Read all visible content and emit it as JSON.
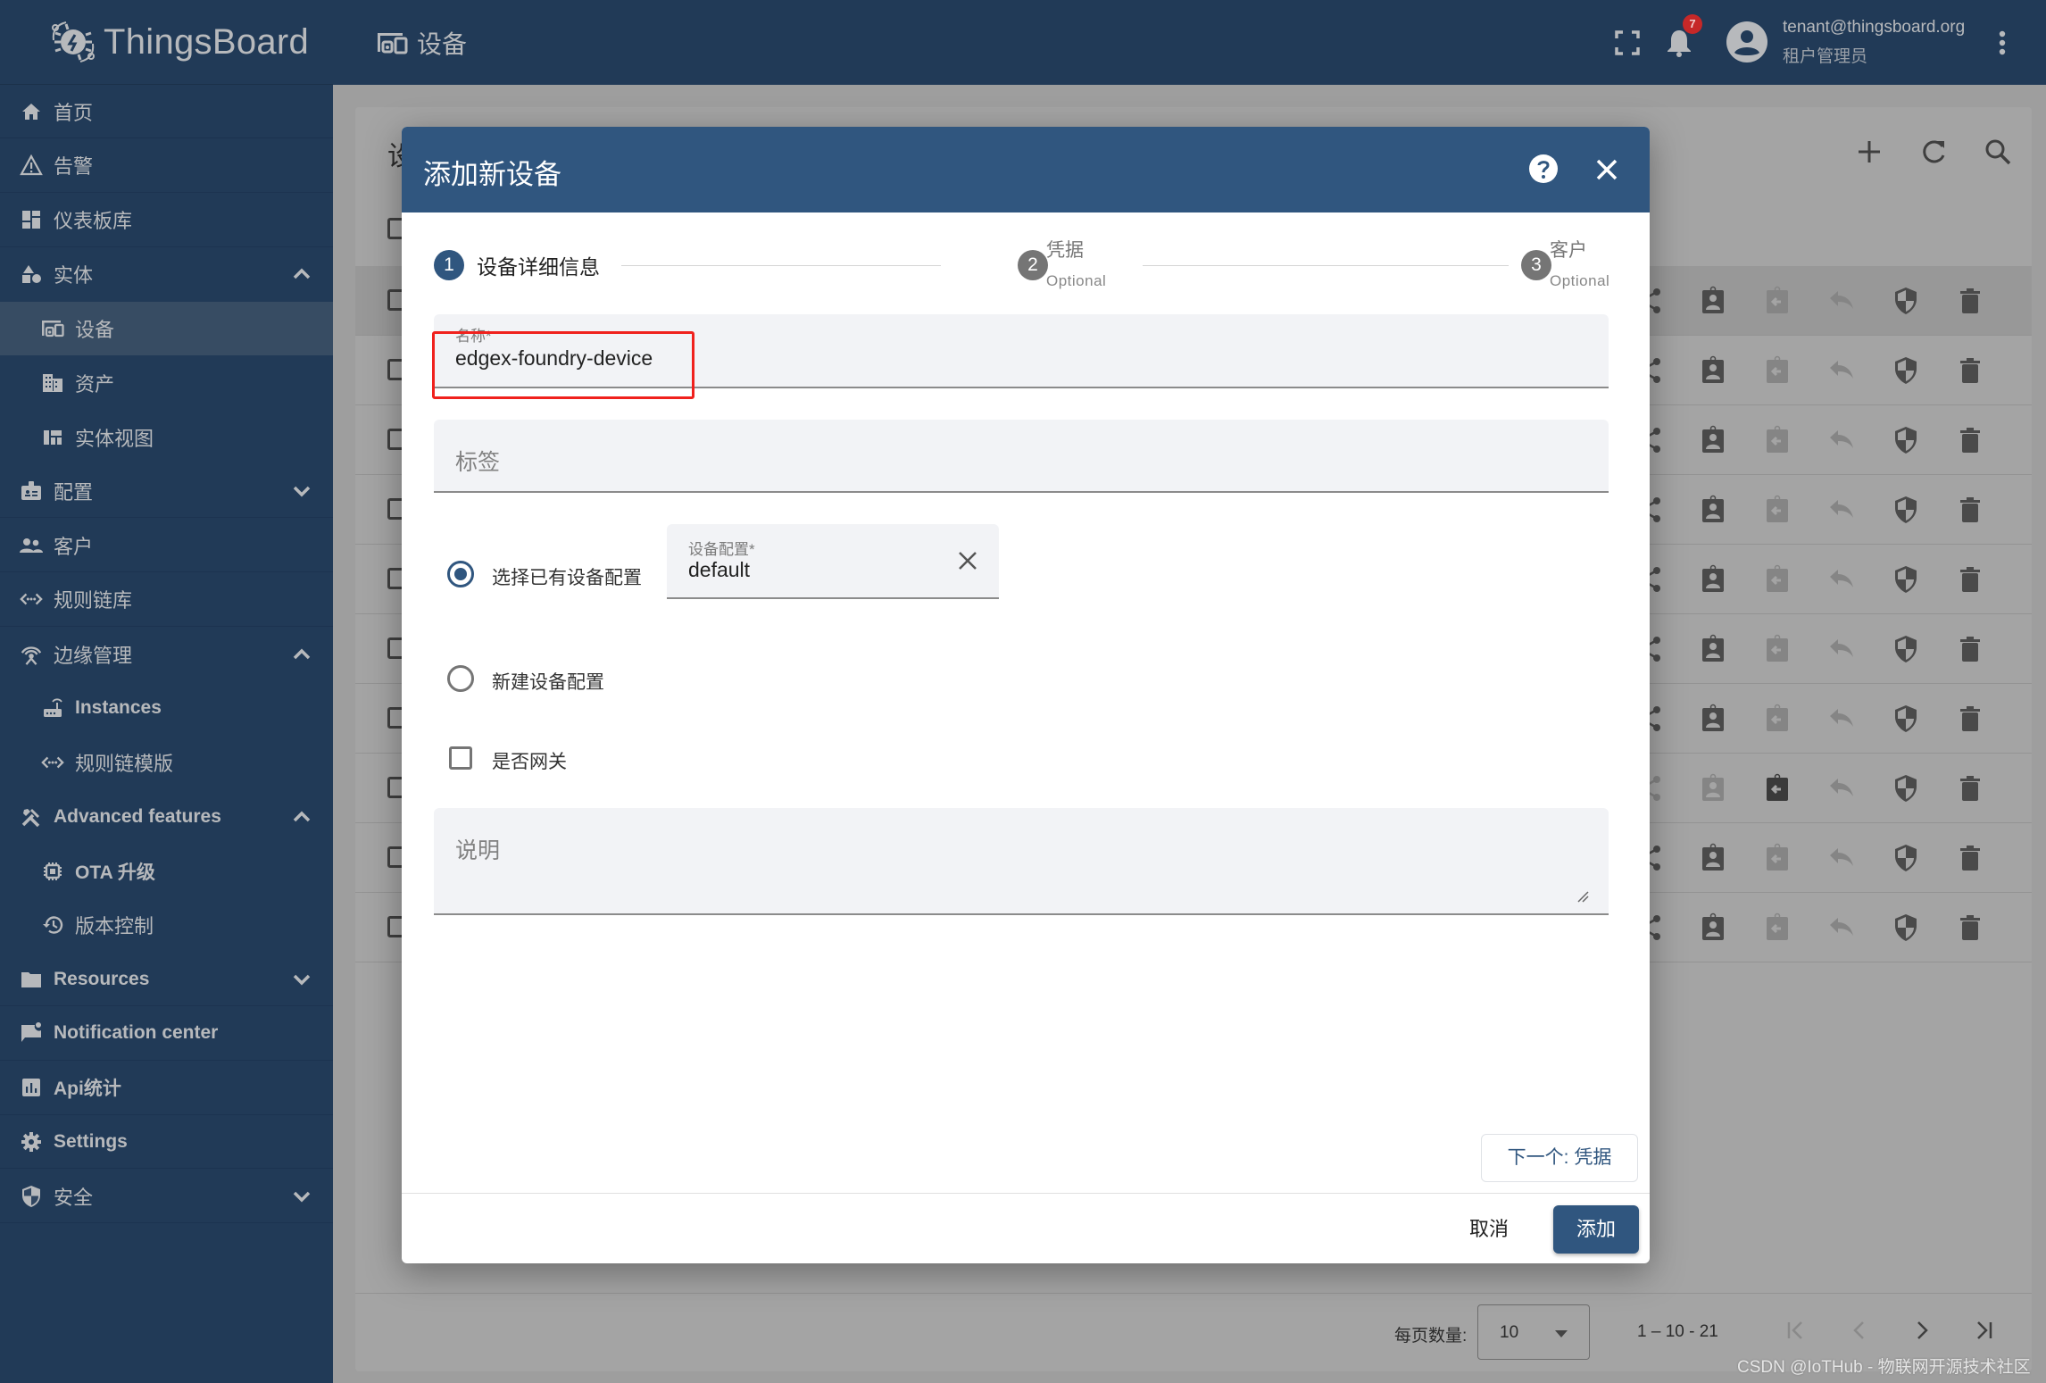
{
  "app": {
    "brand": "ThingsBoard",
    "page_title": "设备"
  },
  "topbar": {
    "notification_count": "7",
    "user_email": "tenant@thingsboard.org",
    "user_role": "租户管理员"
  },
  "sidebar": {
    "items": [
      {
        "label": "首页",
        "icon": "home-icon",
        "level": "top"
      },
      {
        "label": "告警",
        "icon": "warning-icon",
        "level": "top"
      },
      {
        "label": "仪表板库",
        "icon": "dashboard-icon",
        "level": "top"
      },
      {
        "label": "实体",
        "icon": "category-icon",
        "level": "top",
        "expanded": true
      },
      {
        "label": "设备",
        "icon": "devices-icon",
        "level": "child",
        "active": true
      },
      {
        "label": "资产",
        "icon": "domain-icon",
        "level": "child"
      },
      {
        "label": "实体视图",
        "icon": "view-quilt-icon",
        "level": "child"
      },
      {
        "label": "配置",
        "icon": "badge-icon",
        "level": "top",
        "expanded": false
      },
      {
        "label": "客户",
        "icon": "supervisor-account-icon",
        "level": "top"
      },
      {
        "label": "规则链库",
        "icon": "settings-ethernet-icon",
        "level": "top"
      },
      {
        "label": "边缘管理",
        "icon": "router-icon",
        "level": "top",
        "expanded": true
      },
      {
        "label": "Instances",
        "icon": "edge-router-icon",
        "level": "child"
      },
      {
        "label": "规则链模版",
        "icon": "settings-ethernet-icon",
        "level": "child"
      },
      {
        "label": "Advanced features",
        "icon": "construction-icon",
        "level": "top",
        "expanded": true
      },
      {
        "label": "OTA 升级",
        "icon": "memory-chip-icon",
        "level": "child"
      },
      {
        "label": "版本控制",
        "icon": "history-icon",
        "level": "child"
      },
      {
        "label": "Resources",
        "icon": "folder-icon",
        "level": "top",
        "expanded": false
      },
      {
        "label": "Notification center",
        "icon": "mark-chat-unread-icon",
        "level": "top"
      },
      {
        "label": "Api统计",
        "icon": "insert-chart-icon",
        "level": "top"
      },
      {
        "label": "Settings",
        "icon": "gear-icon",
        "level": "top"
      },
      {
        "label": "安全",
        "icon": "security-shield-icon",
        "level": "top",
        "expanded": false
      }
    ]
  },
  "background": {
    "card_title_partial": "设",
    "row_count": 10,
    "rows": [
      {
        "share": true,
        "assign": true,
        "unassign": false,
        "make_public": false
      },
      {
        "share": true,
        "assign": true,
        "unassign": false,
        "make_public": false
      },
      {
        "share": true,
        "assign": true,
        "unassign": false,
        "make_public": false
      },
      {
        "share": true,
        "assign": true,
        "unassign": false,
        "make_public": false
      },
      {
        "share": true,
        "assign": true,
        "unassign": false,
        "make_public": false
      },
      {
        "share": true,
        "assign": true,
        "unassign": false,
        "make_public": false
      },
      {
        "share": true,
        "assign": true,
        "unassign": false,
        "make_public": false
      },
      {
        "share": false,
        "assign": false,
        "unassign": true,
        "make_public": false
      },
      {
        "share": true,
        "assign": true,
        "unassign": false,
        "make_public": false
      },
      {
        "share": true,
        "assign": true,
        "unassign": false,
        "make_public": false
      }
    ],
    "pager": {
      "page_size_label": "每页数量:",
      "page_size": "10",
      "range": "1 – 10 - 21"
    }
  },
  "dialog": {
    "title": "添加新设备",
    "steps": [
      {
        "number": "1",
        "label": "设备详细信息",
        "optional": "",
        "active": true
      },
      {
        "number": "2",
        "label": "凭据",
        "optional": "Optional",
        "active": false
      },
      {
        "number": "3",
        "label": "客户",
        "optional": "Optional",
        "active": false
      }
    ],
    "name_field": {
      "label": "名称*",
      "value": "edgex-foundry-device"
    },
    "label_field": {
      "placeholder": "标签"
    },
    "profile_options": {
      "existing": "选择已有设备配置",
      "new": "新建设备配置",
      "selected": "existing"
    },
    "profile_field": {
      "label": "设备配置*",
      "value": "default"
    },
    "gateway_checkbox": {
      "label": "是否网关",
      "checked": false
    },
    "description_field": {
      "placeholder": "说明"
    },
    "next_button": "下一个: 凭据",
    "cancel_button": "取消",
    "add_button": "添加"
  },
  "colors": {
    "primary": "#30567f",
    "sidebar_bg": "#213a57",
    "highlight_box": "#f0211d",
    "badge": "#c62828"
  },
  "watermark": "CSDN @IoTHub - 物联网开源技术社区"
}
